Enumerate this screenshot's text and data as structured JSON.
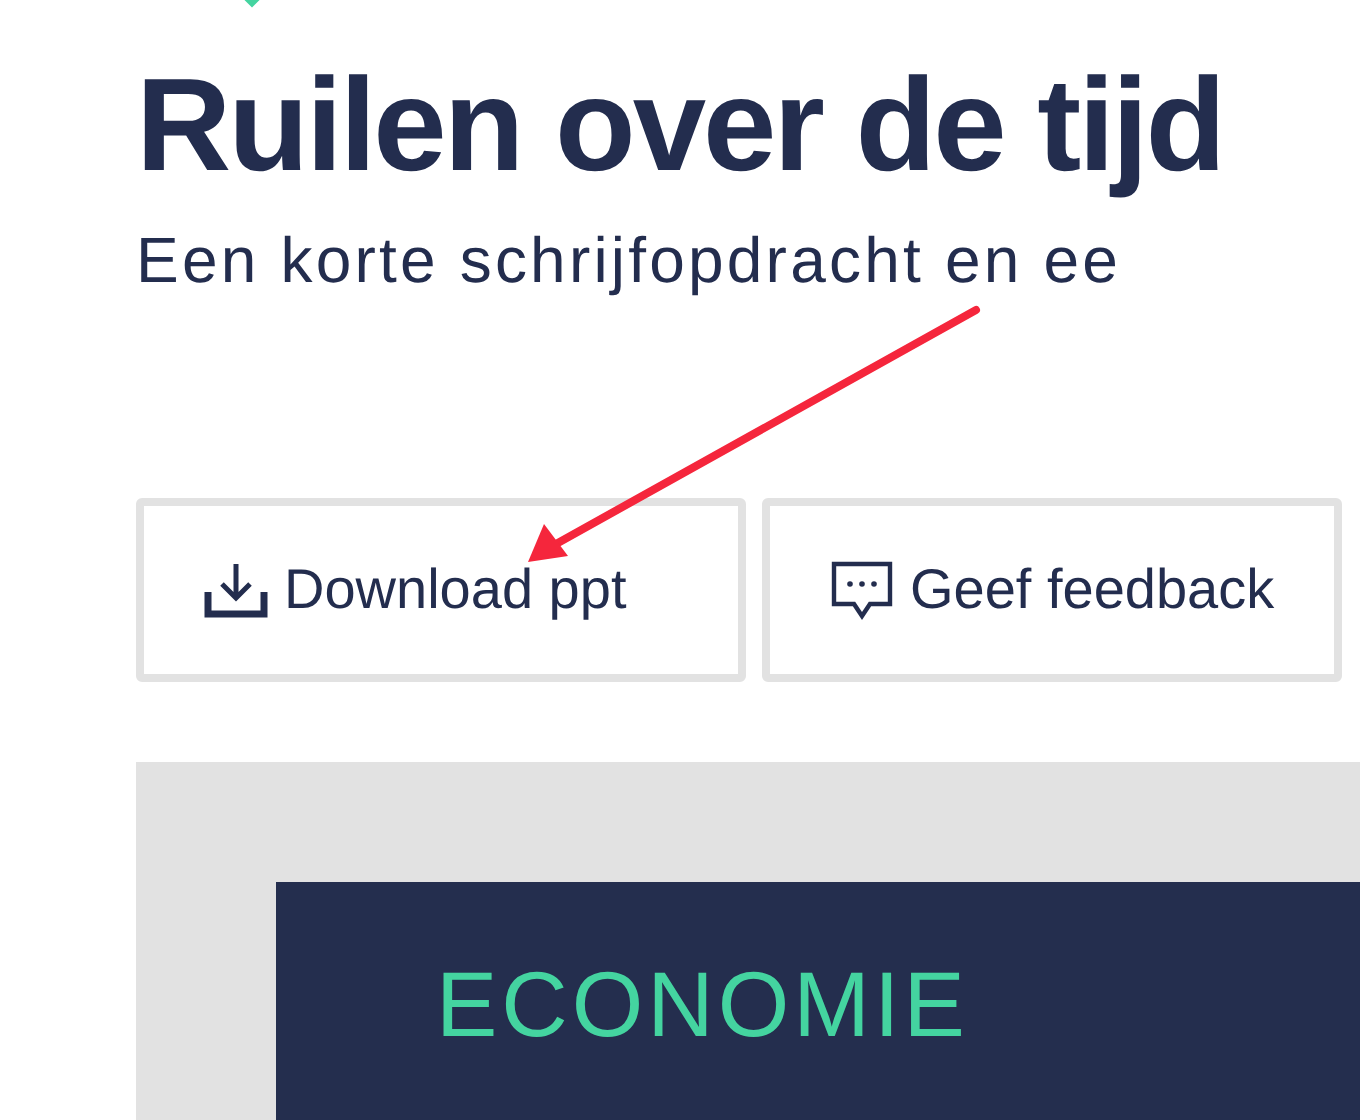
{
  "heading": {
    "title": "Ruilen over de tijd",
    "subtitle": "Een korte schrijfopdracht en ee"
  },
  "buttons": [
    {
      "label": "Download ppt",
      "kind": "download"
    },
    {
      "label": "Geef feedback",
      "kind": "feedback"
    }
  ],
  "slide": {
    "label": "ECONOMIE"
  }
}
